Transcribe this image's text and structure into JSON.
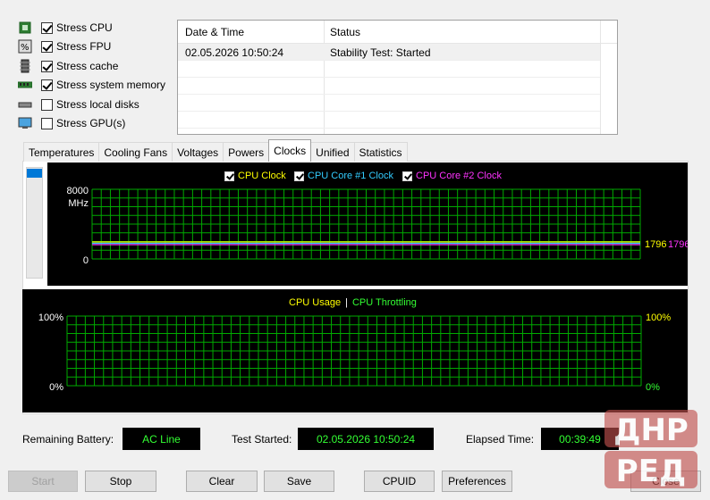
{
  "stress_options": [
    {
      "label": "Stress CPU",
      "checked": true,
      "icon": "cpu-icon"
    },
    {
      "label": "Stress FPU",
      "checked": true,
      "icon": "fpu-icon"
    },
    {
      "label": "Stress cache",
      "checked": true,
      "icon": "cache-icon"
    },
    {
      "label": "Stress system memory",
      "checked": true,
      "icon": "memory-icon"
    },
    {
      "label": "Stress local disks",
      "checked": false,
      "icon": "disk-icon"
    },
    {
      "label": "Stress GPU(s)",
      "checked": false,
      "icon": "gpu-icon"
    }
  ],
  "log": {
    "columns": [
      "Date & Time",
      "Status"
    ],
    "rows": [
      {
        "datetime": "02.05.2026 10:50:24",
        "status": "Stability Test: Started"
      }
    ]
  },
  "tabs": [
    "Temperatures",
    "Cooling Fans",
    "Voltages",
    "Powers",
    "Clocks",
    "Unified",
    "Statistics"
  ],
  "active_tab": "Clocks",
  "clock_chart": {
    "legend": [
      {
        "label": "CPU Clock",
        "color": "#ffff00"
      },
      {
        "label": "CPU Core #1 Clock",
        "color": "#33ccff"
      },
      {
        "label": "CPU Core #2 Clock",
        "color": "#ff33ff"
      }
    ],
    "y_max_label": "8000",
    "y_unit_label": "MHz",
    "y_min_label": "0",
    "value_labels": [
      "1796",
      "1796"
    ],
    "value_label_colors": [
      "#ffff00",
      "#ff33ff"
    ],
    "grid_color": "#00aa00"
  },
  "chart_data": [
    {
      "type": "line",
      "series": [
        {
          "name": "CPU Clock",
          "color": "#ffff00",
          "values": [
            1796
          ]
        },
        {
          "name": "CPU Core #1 Clock",
          "color": "#33ccff",
          "values": [
            1796
          ]
        },
        {
          "name": "CPU Core #2 Clock",
          "color": "#ff33ff",
          "values": [
            1796
          ]
        }
      ],
      "ylim": [
        0,
        8000
      ],
      "ylabel": "MHz",
      "grid": true
    },
    {
      "type": "line",
      "series": [
        {
          "name": "CPU Usage",
          "color": "#ffff00",
          "values": []
        },
        {
          "name": "CPU Throttling",
          "color": "#33ff33",
          "values": []
        }
      ],
      "ylim": [
        0,
        100
      ],
      "grid": true
    }
  ],
  "usage_chart": {
    "legend_usage": "CPU Usage",
    "legend_sep": "|",
    "legend_throttling": "CPU Throttling",
    "usage_color": "#ffff00",
    "throttling_color": "#33ff33",
    "left_top_label": "100%",
    "left_bottom_label": "0%",
    "right_top_label": "100%",
    "right_bottom_label": "0%"
  },
  "status": {
    "battery_label": "Remaining Battery:",
    "battery_value": "AC Line",
    "started_label": "Test Started:",
    "started_value": "02.05.2026 10:50:24",
    "elapsed_label": "Elapsed Time:",
    "elapsed_value": "00:39:49"
  },
  "buttons": {
    "start": "Start",
    "stop": "Stop",
    "clear": "Clear",
    "save": "Save",
    "cpuid": "CPUID",
    "preferences": "Preferences",
    "close": "Close"
  },
  "watermark": {
    "line1": "ДНР",
    "line2": "РЕД"
  }
}
